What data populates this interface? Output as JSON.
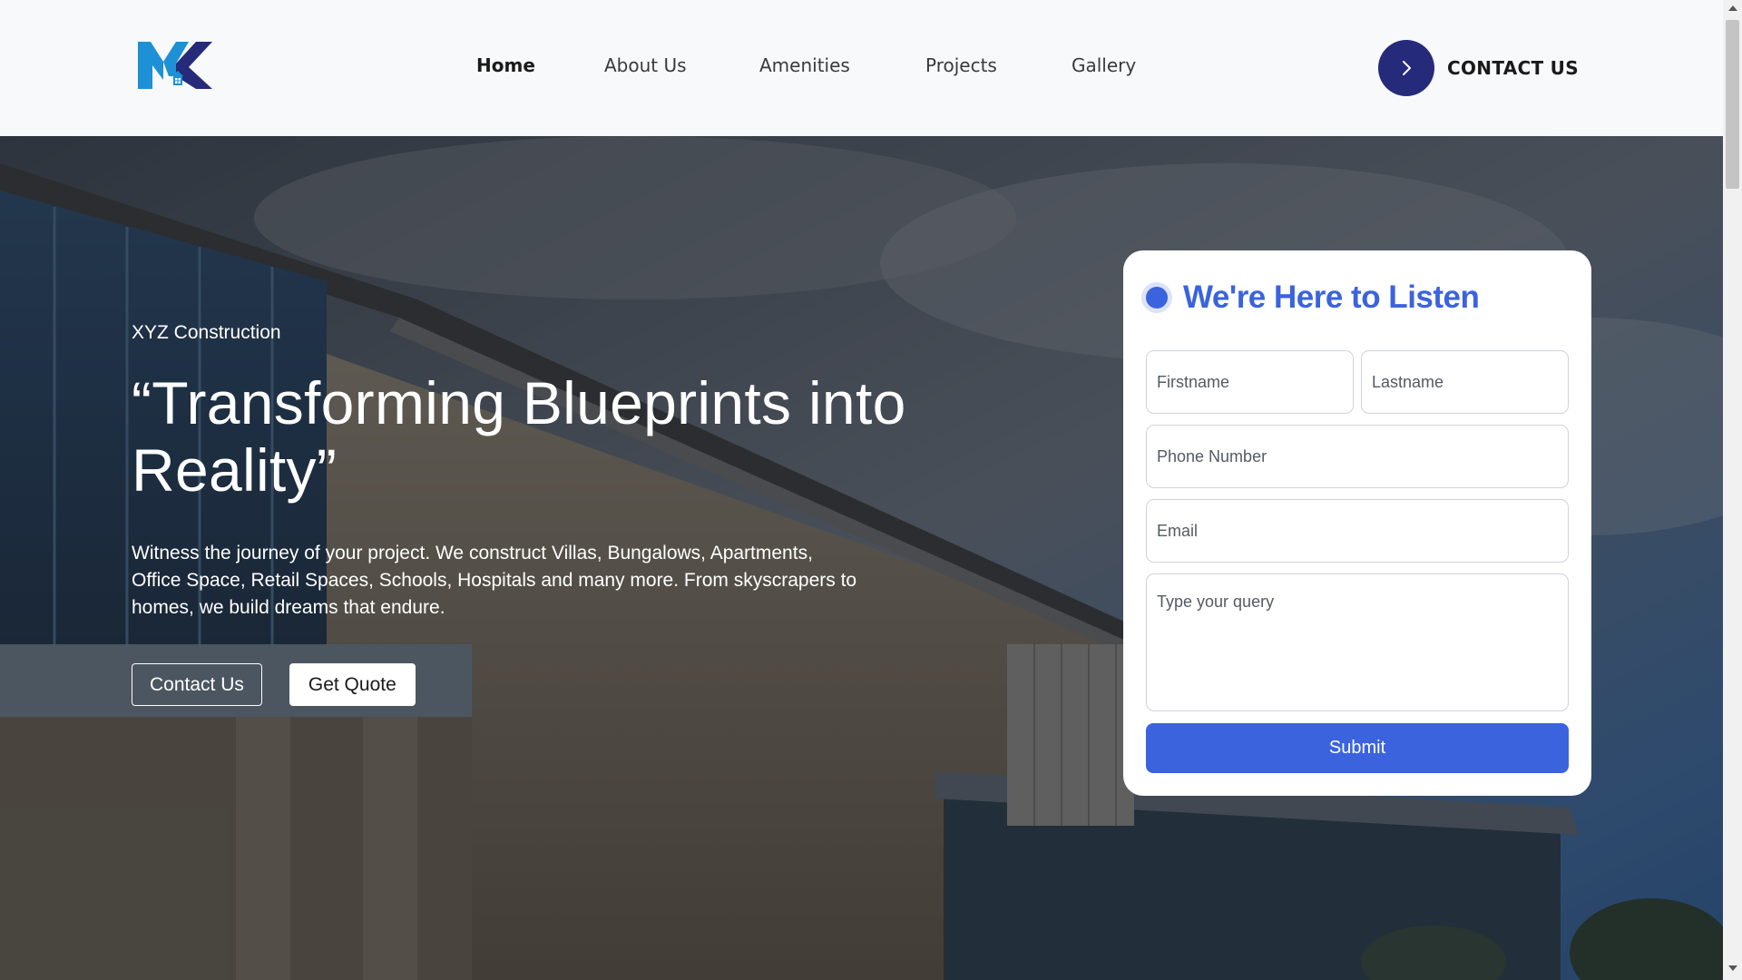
{
  "header": {
    "logo_icon": "mk-house-logo",
    "nav": [
      {
        "label": "Home",
        "active": true
      },
      {
        "label": "About Us",
        "active": false
      },
      {
        "label": "Amenities",
        "active": false
      },
      {
        "label": "Projects",
        "active": false
      },
      {
        "label": "Gallery",
        "active": false
      }
    ],
    "cta": {
      "label": "CONTACT US",
      "icon": "chevron-right-icon"
    }
  },
  "hero": {
    "eyebrow": "XYZ Construction",
    "headline": "“Transforming Blueprints into Reality”",
    "lead": "Witness the journey of your project. We construct Villas, Bungalows, Apartments, Office Space, Retail Spaces, Schools, Hospitals and many more. From skyscrapers to homes, we build dreams that endure.",
    "primary_button": "Contact Us",
    "secondary_button": "Get Quote"
  },
  "form": {
    "title": "We're Here to Listen",
    "firstname_placeholder": "Firstname",
    "lastname_placeholder": "Lastname",
    "phone_placeholder": "Phone Number",
    "email_placeholder": "Email",
    "query_placeholder": "Type your query",
    "submit_label": "Submit"
  },
  "colors": {
    "accent": "#3b63de",
    "cta_circle": "#252b7a",
    "logo_blue": "#1e90d6",
    "logo_navy": "#252b7a"
  }
}
